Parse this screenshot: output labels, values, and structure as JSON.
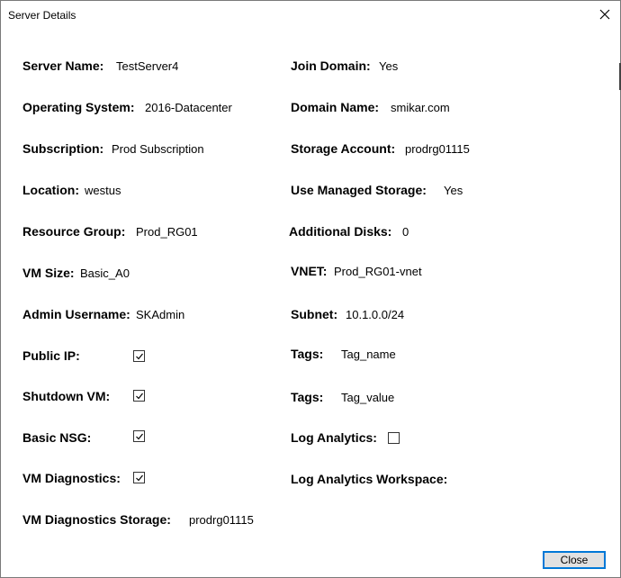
{
  "window": {
    "title": "Server Details"
  },
  "left": {
    "server_name": {
      "label": "Server Name:",
      "value": "TestServer4"
    },
    "operating_system": {
      "label": "Operating System:",
      "value": "2016-Datacenter"
    },
    "subscription": {
      "label": "Subscription:",
      "value": "Prod Subscription"
    },
    "location": {
      "label": "Location:",
      "value": "westus"
    },
    "resource_group": {
      "label": "Resource Group:",
      "value": "Prod_RG01"
    },
    "vm_size": {
      "label": "VM Size:",
      "value": "Basic_A0"
    },
    "admin_username": {
      "label": "Admin Username:",
      "value": "SKAdmin"
    },
    "public_ip": {
      "label": "Public IP:",
      "checked": true
    },
    "shutdown_vm": {
      "label": "Shutdown VM:",
      "checked": true
    },
    "basic_nsg": {
      "label": "Basic NSG:",
      "checked": true
    },
    "vm_diagnostics": {
      "label": "VM Diagnostics:",
      "checked": true
    },
    "vm_diagnostics_storage": {
      "label": "VM Diagnostics Storage:",
      "value": "prodrg01115"
    }
  },
  "right": {
    "join_domain": {
      "label": "Join Domain:",
      "value": "Yes"
    },
    "domain_name": {
      "label": "Domain Name:",
      "value": "smikar.com"
    },
    "storage_account": {
      "label": "Storage Account:",
      "value": "prodrg01115"
    },
    "use_managed_storage": {
      "label": "Use Managed Storage:",
      "value": "Yes"
    },
    "additional_disks": {
      "label": "Additional Disks:",
      "value": "0"
    },
    "vnet": {
      "label": "VNET:",
      "value": "Prod_RG01-vnet"
    },
    "subnet": {
      "label": "Subnet:",
      "value": "10.1.0.0/24"
    },
    "tags_name": {
      "label": "Tags:",
      "value": "Tag_name"
    },
    "tags_value": {
      "label": "Tags:",
      "value": "Tag_value"
    },
    "log_analytics": {
      "label": "Log Analytics:",
      "checked": false
    },
    "log_analytics_workspace": {
      "label": "Log Analytics Workspace:",
      "value": ""
    }
  },
  "buttons": {
    "close_label": "Close"
  },
  "icons": {
    "close": "close-icon",
    "check": "checkmark-icon"
  }
}
